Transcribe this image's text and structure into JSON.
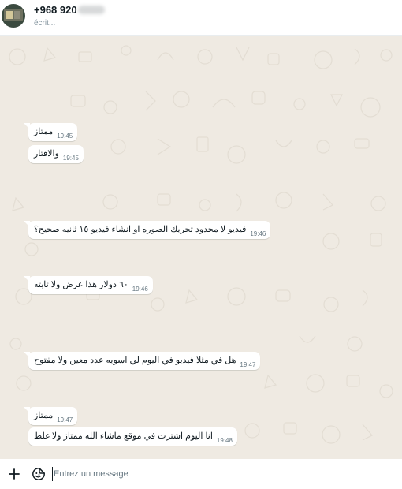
{
  "header": {
    "contact_name": "+968 920",
    "status": "écrit..."
  },
  "messages": [
    {
      "text": "ممتاز",
      "time": "19:45"
    },
    {
      "text": "والافتار",
      "time": "19:45"
    },
    {
      "text": "فيديو لا محدود تحريك الصوره او انشاء فيديو ١٥ ثانيه صحيح؟",
      "time": "19:46"
    },
    {
      "text": "٦٠ دولار هذا عرض ولا ثابته",
      "time": "19:46"
    },
    {
      "text": "هل في مثلا فيديو في اليوم لي اسويه عدد معين ولا مفتوح",
      "time": "19:47"
    },
    {
      "text": "ممتاز",
      "time": "19:47"
    },
    {
      "text": "انا اليوم اشترت في موقع ماشاء الله ممتاز ولا غلط",
      "time": "19:48"
    }
  ],
  "composer": {
    "placeholder": "Entrez un message",
    "value": ""
  },
  "icons": {
    "attach": "plus-icon",
    "stickers": "sticker-icon",
    "profile": "avatar"
  },
  "colors": {
    "chat_background": "#efeae2",
    "bubble": "#ffffff",
    "header_background": "#ffffff"
  }
}
